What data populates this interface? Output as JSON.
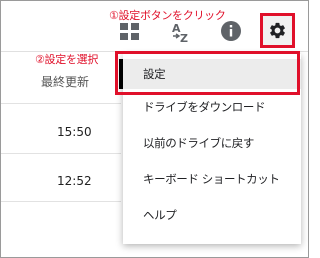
{
  "toolbar": {
    "icons": [
      "grid-view-icon",
      "sort-az-icon",
      "info-icon",
      "gear-icon"
    ]
  },
  "annotations": {
    "step1": "①設定ボタンをクリック",
    "step2": "②設定を選択"
  },
  "list": {
    "column_header": "最終更新",
    "rows": [
      {
        "time": "15:50"
      },
      {
        "time": "12:52"
      }
    ]
  },
  "menu": {
    "items": [
      {
        "label": "設定",
        "selected": true
      },
      {
        "label": "ドライブをダウンロード"
      },
      {
        "label": "以前のドライブに戻す"
      },
      {
        "label": "キーボード ショートカット"
      },
      {
        "label": "ヘルプ"
      }
    ]
  },
  "colors": {
    "annotation_red": "#e0102a",
    "icon_gray": "#5f6368"
  }
}
